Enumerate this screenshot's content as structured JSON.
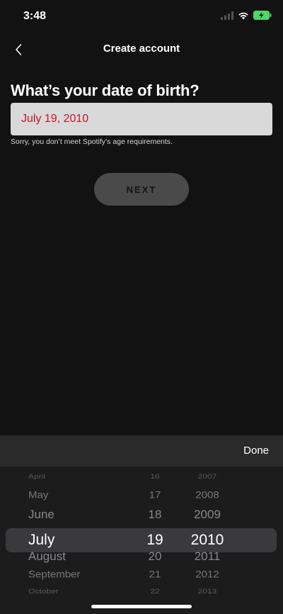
{
  "status_bar": {
    "time": "3:48",
    "wifi_icon": "wifi-icon",
    "battery_icon": "battery-charging-icon"
  },
  "nav": {
    "title": "Create account",
    "back_icon": "chevron-left-icon"
  },
  "form": {
    "question": "What’s your date of birth?",
    "dob_value": "July 19, 2010",
    "error": "Sorry, you don’t meet Spotify’s age requirements.",
    "next_label": "NEXT"
  },
  "picker": {
    "done_label": "Done",
    "months": [
      "April",
      "May",
      "June",
      "July",
      "August",
      "September",
      "October"
    ],
    "days": [
      "16",
      "17",
      "18",
      "19",
      "20",
      "21",
      "22"
    ],
    "years": [
      "2007",
      "2008",
      "2009",
      "2010",
      "2011",
      "2012",
      "2013"
    ],
    "selected_index": 3
  },
  "colors": {
    "accent_error": "#c4162a",
    "background": "#121212",
    "battery": "#4cd964"
  }
}
